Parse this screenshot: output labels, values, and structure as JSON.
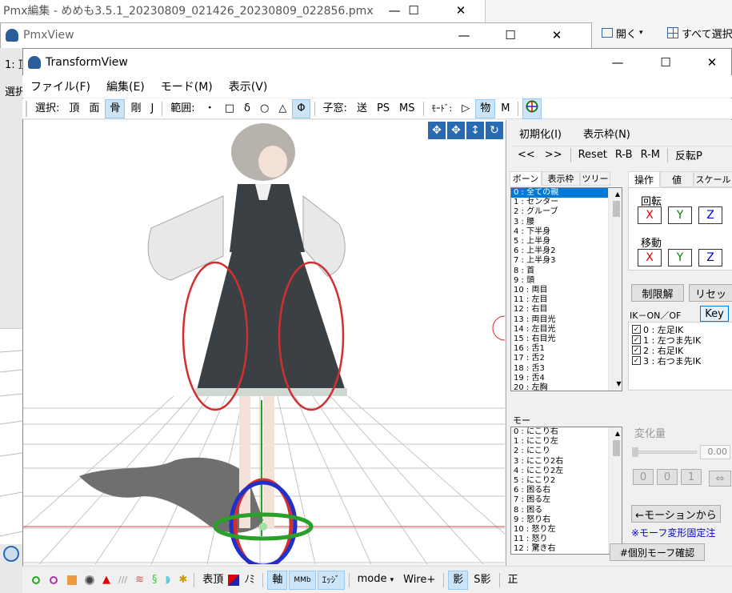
{
  "back_window": {
    "title": "Pmx編集 - めめも3.5.1_20230809_021426_20230809_022856.pmx",
    "side_buttons": [
      "開く",
      "すべて選択"
    ],
    "tab_fragment": "1: 頂",
    "sel_fragment": "選択"
  },
  "pmxview": {
    "title": "PmxView"
  },
  "transform": {
    "title": "TransformView",
    "menu": [
      "ファイル(F)",
      "編集(E)",
      "モード(M)",
      "表示(V)"
    ],
    "toolbar": [
      "選択:",
      "頂",
      "面",
      "骨",
      "剛",
      "J",
      "範囲:",
      "・",
      "□",
      "δ",
      "○",
      "△",
      "Φ",
      "子窓:",
      "送",
      "PS",
      "MS",
      "ﾓｰﾄﾞ:",
      "▷",
      "物",
      "M"
    ],
    "top_buttons": {
      "init": "初期化(I)",
      "frame": "表示枠(N)",
      "prev": "<<",
      "next": ">>",
      "reset": "Reset",
      "rb": "R-B",
      "rm": "R-M",
      "flip": "反転P"
    },
    "bone_tabs": [
      "ボーン",
      "表示枠",
      "ツリー"
    ],
    "bones": [
      "0 : 全ての親",
      "1 : センター",
      "2 : グルーブ",
      "3 : 腰",
      "4 : 下半身",
      "5 : 上半身",
      "6 : 上半身2",
      "7 : 上半身3",
      "8 : 首",
      "9 : 頭",
      "10 : 両目",
      "11 : 左目",
      "12 : 右目",
      "13 : 両目光",
      "14 : 左目光",
      "15 : 右目光",
      "16 : 舌1",
      "17 : 舌2",
      "18 : 舌3",
      "19 : 舌4",
      "20 : 左胸"
    ],
    "morph_label": "モー",
    "morphs": [
      "0 : にこり右",
      "1 : にこり左",
      "2 : にこり",
      "3 : にこり2右",
      "4 : にこり2左",
      "5 : にこり2",
      "6 : 困る右",
      "7 : 困る左",
      "8 : 困る",
      "9 : 怒り右",
      "10 : 怒り左",
      "11 : 怒り",
      "12 : 驚き右"
    ],
    "op_tabs": [
      "操作",
      "値",
      "スケール"
    ],
    "rotate_label": "回転",
    "move_label": "移動",
    "axes": [
      "X",
      "Y",
      "Z"
    ],
    "axis_colors": {
      "x": "#e00000",
      "y": "#008000",
      "z": "#0000d0"
    },
    "limit_button": "制限解",
    "reset_button": "リセッ",
    "ik_label": "IK－ON／OF",
    "key_button": "Key",
    "ik_items": [
      "0 : 左足IK",
      "1 : 左つま先IK",
      "2 : 右足IK",
      "3 : 右つま先IK"
    ],
    "change_label": "変化量",
    "value": "0.00",
    "small_buttons": [
      "0",
      "0",
      "1"
    ],
    "swap_icon": "⇔",
    "from_motion": "←モーションから",
    "morph_note": "※モーフ変形固定注",
    "morph_check": "#個別モーフ確認",
    "bottom": [
      "表頂",
      "ﾉﾐ",
      "軸",
      "ｴｯｼﾞ",
      "mode",
      "Wire+",
      "影",
      "S影",
      "正"
    ],
    "bottom_nums": "MMb"
  }
}
